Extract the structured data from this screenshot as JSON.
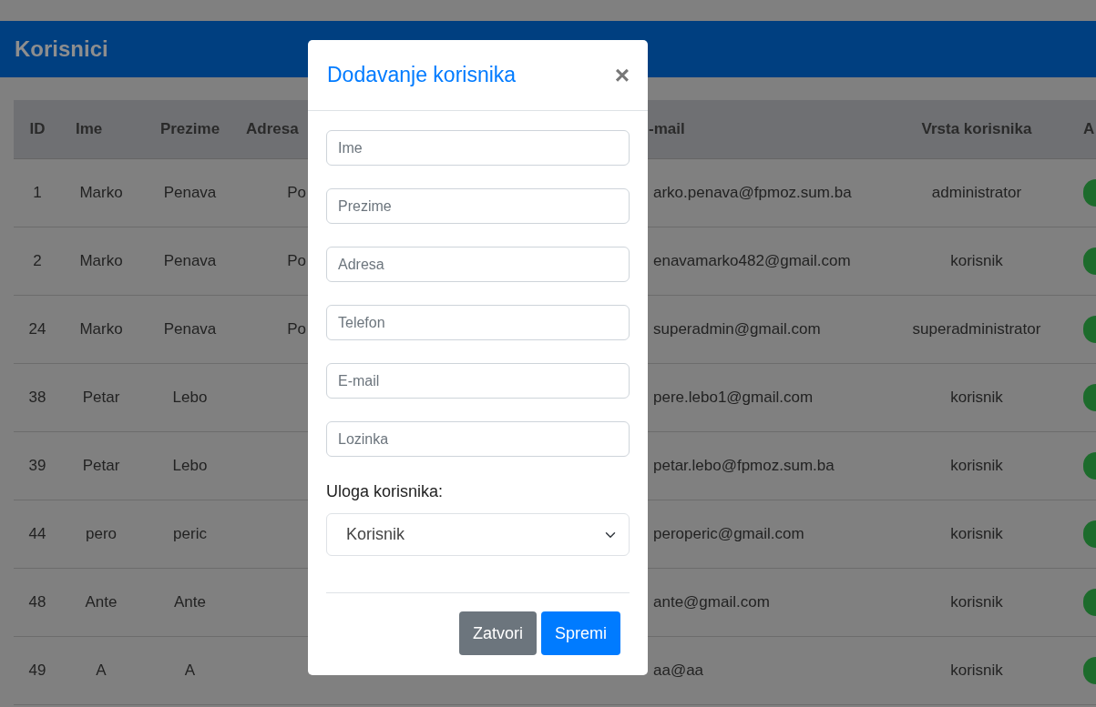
{
  "page": {
    "title": "Korisnici"
  },
  "table": {
    "columns": [
      "ID",
      "Ime",
      "Prezime",
      "Adresa",
      "-mail",
      "Vrsta korisnika",
      "A"
    ],
    "rows": [
      {
        "id": "1",
        "first_name": "Marko",
        "last_name": "Penava",
        "address": "Po",
        "email": "arko.penava@fpmoz.sum.ba",
        "type": "administrator"
      },
      {
        "id": "2",
        "first_name": "Marko",
        "last_name": "Penava",
        "address": "Po",
        "email": "enavamarko482@gmail.com",
        "type": "korisnik"
      },
      {
        "id": "24",
        "first_name": "Marko",
        "last_name": "Penava",
        "address": "Po",
        "email": "superadmin@gmail.com",
        "type": "superadministrator"
      },
      {
        "id": "38",
        "first_name": "Petar",
        "last_name": "Lebo",
        "email": "pere.lebo1@gmail.com",
        "type": "korisnik"
      },
      {
        "id": "39",
        "first_name": "Petar",
        "last_name": "Lebo",
        "email": "petar.lebo@fpmoz.sum.ba",
        "type": "korisnik"
      },
      {
        "id": "44",
        "first_name": "pero",
        "last_name": "peric",
        "email": "peroperic@gmail.com",
        "type": "korisnik"
      },
      {
        "id": "48",
        "first_name": "Ante",
        "last_name": "Ante",
        "email": "ante@gmail.com",
        "type": "korisnik"
      },
      {
        "id": "49",
        "first_name": "A",
        "last_name": "A",
        "email": "aa@aa",
        "type": "korisnik"
      }
    ]
  },
  "modal": {
    "title": "Dodavanje korisnika",
    "close_label": "×",
    "fields": [
      {
        "placeholder": "Ime"
      },
      {
        "placeholder": "Prezime"
      },
      {
        "placeholder": "Adresa"
      },
      {
        "placeholder": "Telefon"
      },
      {
        "placeholder": "E-mail"
      },
      {
        "placeholder": "Lozinka"
      }
    ],
    "role_label": "Uloga korisnika:",
    "role_select": {
      "value": "Korisnik"
    },
    "buttons": [
      {
        "label": "Zatvori",
        "kind": "secondary"
      },
      {
        "label": "Spremi",
        "kind": "primary"
      }
    ]
  }
}
